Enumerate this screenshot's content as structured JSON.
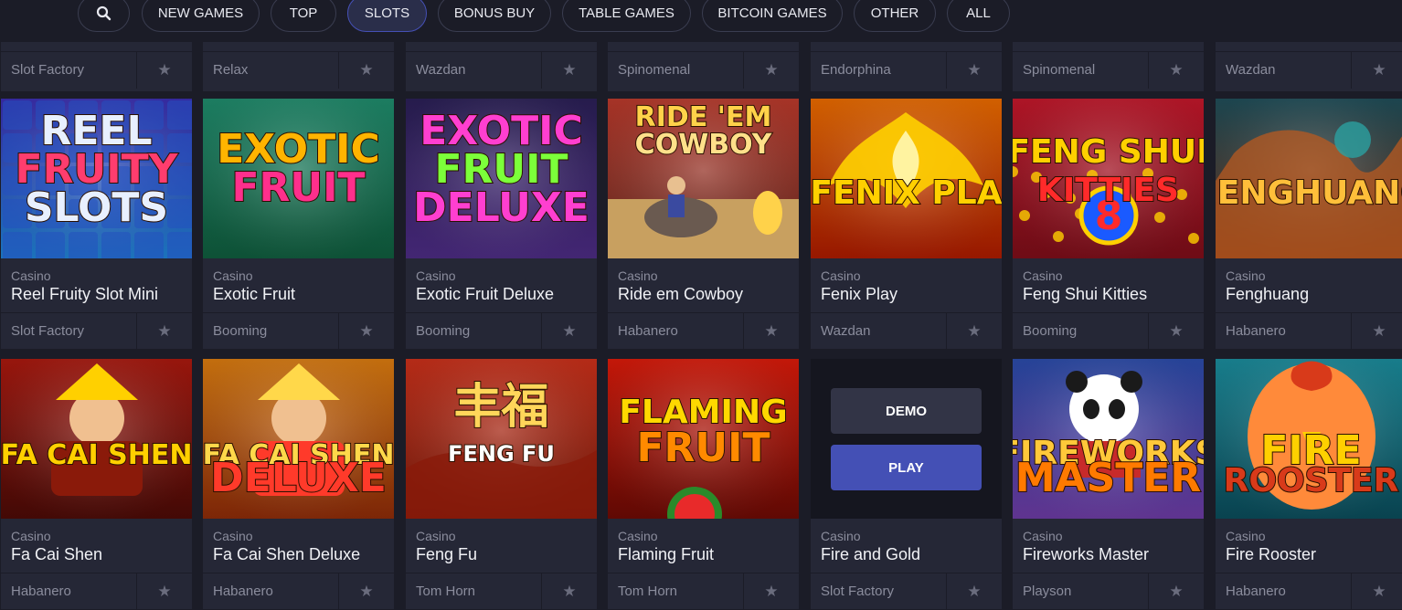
{
  "nav": {
    "tabs": [
      {
        "label": "NEW GAMES"
      },
      {
        "label": "TOP"
      },
      {
        "label": "SLOTS"
      },
      {
        "label": "BONUS BUY"
      },
      {
        "label": "TABLE GAMES"
      },
      {
        "label": "BITCOIN GAMES"
      },
      {
        "label": "OTHER"
      },
      {
        "label": "ALL"
      }
    ],
    "active_tab": "SLOTS",
    "search_icon": "search-icon"
  },
  "top_row_partial": {
    "providers": [
      "Slot Factory",
      "Relax",
      "Wazdan",
      "Spinomenal",
      "Endorphina",
      "Spinomenal",
      "Wazdan"
    ]
  },
  "rows": [
    {
      "games": [
        {
          "category": "Casino",
          "name": "Reel Fruity Slot Mini",
          "provider": "Slot Factory",
          "art": "REEL FRUITY SLOTS"
        },
        {
          "category": "Casino",
          "name": "Exotic Fruit",
          "provider": "Booming",
          "art": "EXOTIC FRUIT"
        },
        {
          "category": "Casino",
          "name": "Exotic Fruit Deluxe",
          "provider": "Booming",
          "art": "EXOTIC FRUIT DELUXE"
        },
        {
          "category": "Casino",
          "name": "Ride em Cowboy",
          "provider": "Habanero",
          "art": "RIDE 'EM COWBOY"
        },
        {
          "category": "Casino",
          "name": "Fenix Play",
          "provider": "Wazdan",
          "art": "FENIX PLA"
        },
        {
          "category": "Casino",
          "name": "Feng Shui Kitties",
          "provider": "Booming",
          "art": "FENG SHUI KITTIES"
        },
        {
          "category": "Casino",
          "name": "Fenghuang",
          "provider": "Habanero",
          "art": "FENGHUANG"
        }
      ]
    },
    {
      "games": [
        {
          "category": "Casino",
          "name": "Fa Cai Shen",
          "provider": "Habanero",
          "art": "FA CAI SHEN"
        },
        {
          "category": "Casino",
          "name": "Fa Cai Shen Deluxe",
          "provider": "Habanero",
          "art": "FA CAI SHEN DELUXE"
        },
        {
          "category": "Casino",
          "name": "Feng Fu",
          "provider": "Tom Horn",
          "art": "丰福 FENG FU"
        },
        {
          "category": "Casino",
          "name": "Flaming Fruit",
          "provider": "Tom Horn",
          "art": "FLAMING FRUIT"
        },
        {
          "category": "Casino",
          "name": "Fire and Gold",
          "provider": "Slot Factory",
          "hover": true
        },
        {
          "category": "Casino",
          "name": "Fireworks Master",
          "provider": "Playson",
          "art": "FIREWORKS MASTER"
        },
        {
          "category": "Casino",
          "name": "Fire Rooster",
          "provider": "Habanero",
          "art": "FIRE ROOSTER"
        }
      ]
    }
  ],
  "hover_buttons": {
    "demo": "DEMO",
    "play": "PLAY"
  },
  "colors": {
    "background": "#1b1c27",
    "card": "#252736",
    "accent": "#4450b5"
  }
}
